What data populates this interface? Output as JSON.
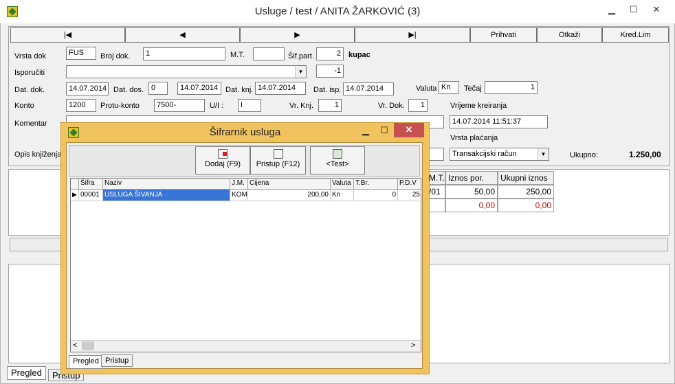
{
  "window": {
    "title": "Usluge / test / ANITA ŽARKOVIĆ (3)",
    "minimize": "▁",
    "maximize": "☐",
    "close": "✕"
  },
  "nav": {
    "first": "|◀",
    "prev": "◀",
    "next": "▶",
    "last": "▶|",
    "accept": "Prihvati",
    "cancel": "Otkaži",
    "credit_limit": "Kred.Lim"
  },
  "form": {
    "vrsta_dok_label": "Vrsta dok",
    "vrsta_dok": "FUS",
    "broj_dok_label": "Broj dok.",
    "broj_dok": "1",
    "mt_label": "M.T.",
    "mt": "",
    "sif_part_label": "Šif.part.",
    "sif_part": "2",
    "partner_type": "kupac",
    "isporuciti_label": "Isporučiti",
    "isporuciti": "",
    "isporuciti_code": "-1",
    "dat_dok_label": "Dat. dok.",
    "dat_dok": "14.07.2014",
    "dat_dos_label": "Dat. dos.",
    "dat_dos_days": "0",
    "dat_dos": "14.07.2014",
    "dat_knj_label": "Dat. knj.",
    "dat_knj": "14.07.2014",
    "dat_isp_label": "Dat. isp.",
    "dat_isp": "14.07.2014",
    "valuta_label": "Valuta",
    "valuta": "Kn",
    "tecaj_label": "Tečaj",
    "tecaj": "1",
    "konto_label": "Konto",
    "konto": "1200",
    "protu_konto_label": "Protu-konto",
    "protu_konto": "7500-",
    "ui_label": "U/I :",
    "ui": "I",
    "vr_knj_label": "Vr. Knj.",
    "vr_knj": "1",
    "vr_dok_label": "Vr. Dok.",
    "vr_dok": "1",
    "vrijeme_label": "Vrijeme kreiranja",
    "vrijeme": "14.07.2014 11:51:37",
    "komentar_label": "Komentar",
    "vrsta_placanja_label": "Vrsta plaćanja",
    "vrsta_placanja": "Transakcijski račun",
    "opis_label": "Opis knjiženja",
    "ukupno_label": "Ukupno:",
    "ukupno": "1.250,00"
  },
  "main_grid": {
    "columns": [
      "M.T.",
      "Iznos por.",
      "Ukupni iznos"
    ],
    "rows": [
      [
        "/01",
        "50,00",
        "250,00"
      ],
      [
        "",
        "0,00",
        "0,00"
      ]
    ]
  },
  "bottom_tabs": {
    "pregled": "Pregled",
    "pristup": "Pristup"
  },
  "dialog": {
    "title": "Šifrarnik usluga",
    "minimize": "▁",
    "maximize": "☐",
    "close": "✕",
    "add": "Dodaj (F9)",
    "access": "Pristup (F12)",
    "test": "<Test>",
    "columns": [
      "Šifra",
      "Naziv",
      "J.M.",
      "Cijena",
      "Valuta",
      "T.Br.",
      "P.D.V"
    ],
    "rows": [
      {
        "sifra": "00001",
        "naziv": "USLUGA ŠIVANJA",
        "jm": "KOM",
        "cijena": "200,00",
        "valuta": "Kn",
        "tbr": "0",
        "pdv": "25"
      }
    ],
    "tab_pregled": "Pregled",
    "tab_pristup": "Pristup",
    "scroll_left": "<",
    "scroll_right": ">"
  }
}
